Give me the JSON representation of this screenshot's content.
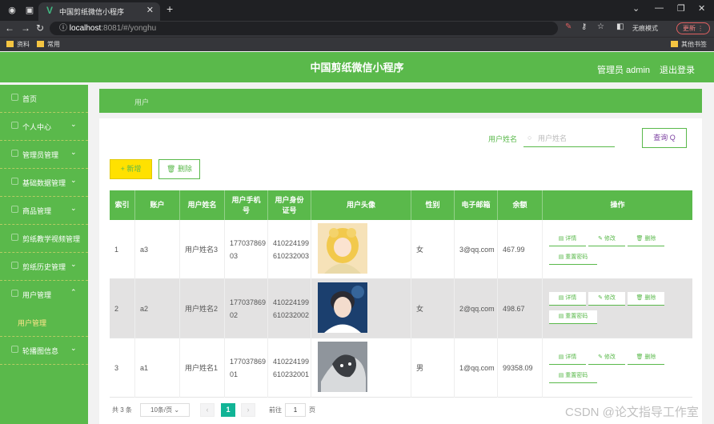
{
  "browser": {
    "tab_title": "中国剪纸微信小程序",
    "url_prefix": "localhost",
    "url_rest": ":8081/#/yonghu",
    "incognito": "无痕模式",
    "update": "更新",
    "bookmarks": [
      "资料",
      "常用"
    ],
    "other_bookmarks": "其他书签"
  },
  "header": {
    "title": "中国剪纸微信小程序",
    "admin": "管理员 admin",
    "logout": "退出登录"
  },
  "sidebar": {
    "items": [
      {
        "label": "首页",
        "chevron": false
      },
      {
        "label": "个人中心",
        "chevron": true
      },
      {
        "label": "管理员管理",
        "chevron": true
      },
      {
        "label": "基础数据管理",
        "chevron": true
      },
      {
        "label": "商品管理",
        "chevron": true
      },
      {
        "label": "剪纸教学视频管理",
        "chevron": false
      },
      {
        "label": "剪纸历史管理",
        "chevron": true
      },
      {
        "label": "用户管理",
        "chevron": true
      },
      {
        "label": "轮播图信息",
        "chevron": true
      }
    ],
    "active_sub": "用户管理"
  },
  "breadcrumb": "用户",
  "search": {
    "label": "用户姓名",
    "placeholder": "用户姓名",
    "button": "查询 Q"
  },
  "actions": {
    "add": "+ 新增",
    "delete": "删除"
  },
  "table": {
    "headers": [
      "索引",
      "账户",
      "用户姓名",
      "用户手机号",
      "用户身份证号",
      "用户头像",
      "性别",
      "电子邮箱",
      "余额",
      "操作"
    ],
    "rows": [
      {
        "index": "1",
        "account": "a3",
        "name": "用户姓名3",
        "phone": "17703786903",
        "idcard": "410224199610232003",
        "gender": "女",
        "email": "3@qq.com",
        "balance": "467.99"
      },
      {
        "index": "2",
        "account": "a2",
        "name": "用户姓名2",
        "phone": "17703786902",
        "idcard": "410224199610232002",
        "gender": "女",
        "email": "2@qq.com",
        "balance": "498.67"
      },
      {
        "index": "3",
        "account": "a1",
        "name": "用户姓名1",
        "phone": "17703786901",
        "idcard": "410224199610232001",
        "gender": "男",
        "email": "1@qq.com",
        "balance": "99358.09"
      }
    ],
    "ops": {
      "detail": "详情",
      "edit": "修改",
      "delete": "删除",
      "reset": "重置密码"
    }
  },
  "pager": {
    "total": "共 3 条",
    "per_page": "10条/页",
    "current": "1",
    "goto": "前往",
    "goto_value": "1",
    "page_unit": "页"
  },
  "watermark": "CSDN @论文指导工作室"
}
